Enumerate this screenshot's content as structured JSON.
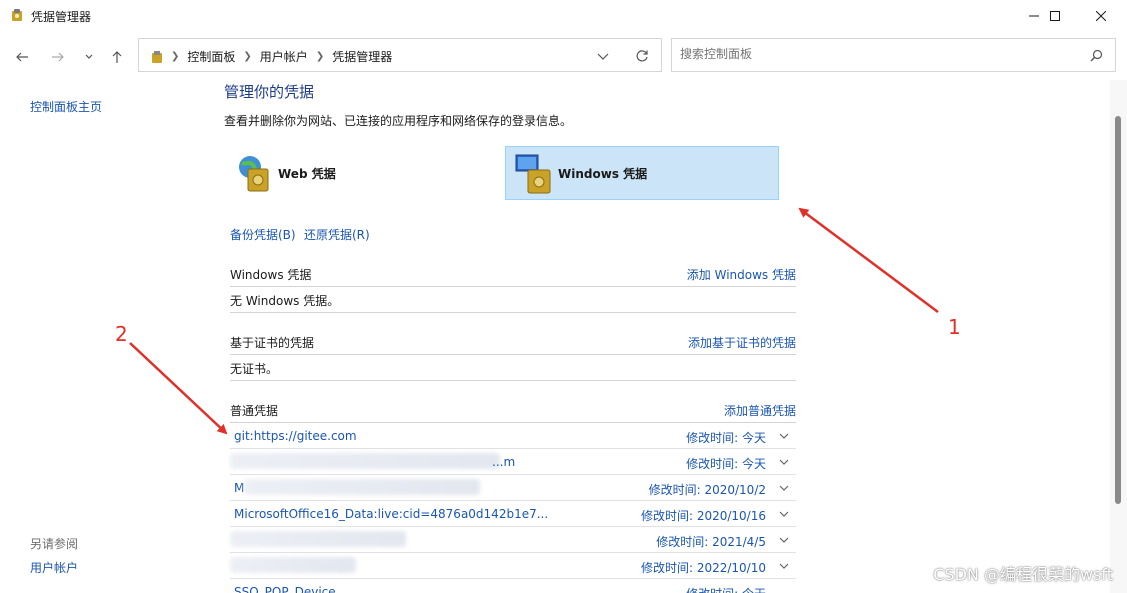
{
  "window": {
    "title": "凭据管理器",
    "controls": [
      "minimize",
      "maximize",
      "close"
    ]
  },
  "navigation": {
    "breadcrumbs": [
      "控制面板",
      "用户帐户",
      "凭据管理器"
    ],
    "search_placeholder": "搜索控制面板"
  },
  "sidebar": {
    "home_link": "控制面板主页",
    "see_also_heading": "另请参阅",
    "see_also_links": [
      "用户帐户"
    ]
  },
  "main": {
    "title": "管理你的凭据",
    "description": "查看并删除你为网站、已连接的应用程序和网络保存的登录信息。",
    "credential_types": [
      {
        "label": "Web 凭据",
        "selected": false
      },
      {
        "label": "Windows 凭据",
        "selected": true
      }
    ],
    "backup_link": "备份凭据(B)",
    "restore_link": "还原凭据(R)",
    "sections": [
      {
        "heading": "Windows 凭据",
        "action": "添加 Windows 凭据",
        "note": "无 Windows 凭据。"
      },
      {
        "heading": "基于证书的凭据",
        "action": "添加基于证书的凭据",
        "note": "无证书。"
      },
      {
        "heading": "普通凭据",
        "action": "添加普通凭据"
      }
    ],
    "generic_credentials": [
      {
        "name": "git:https://gitee.com",
        "modified": "修改时间: 今天"
      },
      {
        "name": "",
        "name_tail": "...m",
        "modified": "修改时间: 今天"
      },
      {
        "name": "M",
        "modified": "修改时间: 2020/10/2"
      },
      {
        "name": "MicrosoftOffice16_Data:live:cid=4876a0d142b1e7...",
        "modified": "修改时间: 2020/10/16"
      },
      {
        "name": "",
        "modified": "修改时间: 2021/4/5"
      },
      {
        "name": "",
        "modified": "修改时间: 2022/10/10"
      },
      {
        "name": "SSO_POP_Device",
        "modified": "修改时间: 今天"
      }
    ]
  },
  "annotations": [
    "1",
    "2"
  ],
  "watermark": "CSDN @编程很菜的wsft",
  "colors": {
    "accent": "#1a56b0",
    "title": "#1e3c87",
    "selected_bg": "#cce4f7",
    "annotation": "#e0302a"
  }
}
